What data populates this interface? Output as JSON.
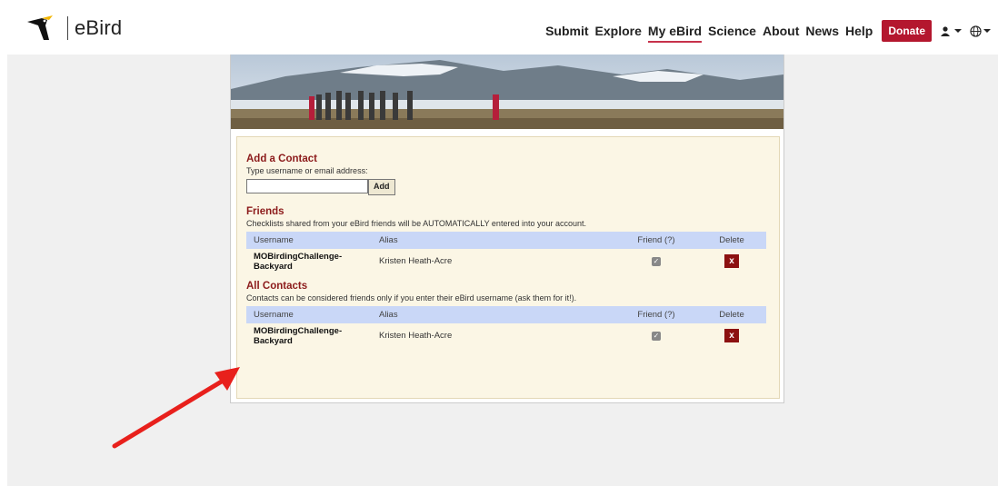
{
  "header": {
    "logo_text": "eBird",
    "nav": [
      "Submit",
      "Explore",
      "My eBird",
      "Science",
      "About",
      "News",
      "Help"
    ],
    "active_nav": "My eBird",
    "donate_label": "Donate"
  },
  "add_contact": {
    "title": "Add a Contact",
    "instruction": "Type username or email address:",
    "input_value": "",
    "button_label": "Add"
  },
  "friends": {
    "title": "Friends",
    "note": "Checklists shared from your eBird friends will be AUTOMATICALLY entered into your account.",
    "columns": [
      "Username",
      "Alias",
      "Friend (?)",
      "Delete"
    ],
    "rows": [
      {
        "username_line1": "MOBirdingChallenge-",
        "username_line2": "Backyard",
        "alias": "Kristen Heath-Acre",
        "friend": true,
        "delete": "x"
      }
    ]
  },
  "all_contacts": {
    "title": "All Contacts",
    "note": "Contacts can be considered friends only if you enter their eBird username (ask them for it!).",
    "columns": [
      "Username",
      "Alias",
      "Friend (?)",
      "Delete"
    ],
    "rows": [
      {
        "username_line1": "MOBirdingChallenge-",
        "username_line2": "Backyard",
        "alias": "Kristen Heath-Acre",
        "friend": true,
        "delete": "x"
      }
    ]
  },
  "colors": {
    "accent": "#b4172e",
    "section_title": "#8c1b1b",
    "table_header": "#c9d7f7",
    "panel_bg": "#fbf6e5",
    "annotation_arrow": "#e8201c"
  },
  "icons": {
    "logo": "ebird-logo-icon",
    "account": "user-icon",
    "language": "globe-icon",
    "friend_check": "checkbox-checked-icon",
    "delete": "delete-x-icon"
  }
}
